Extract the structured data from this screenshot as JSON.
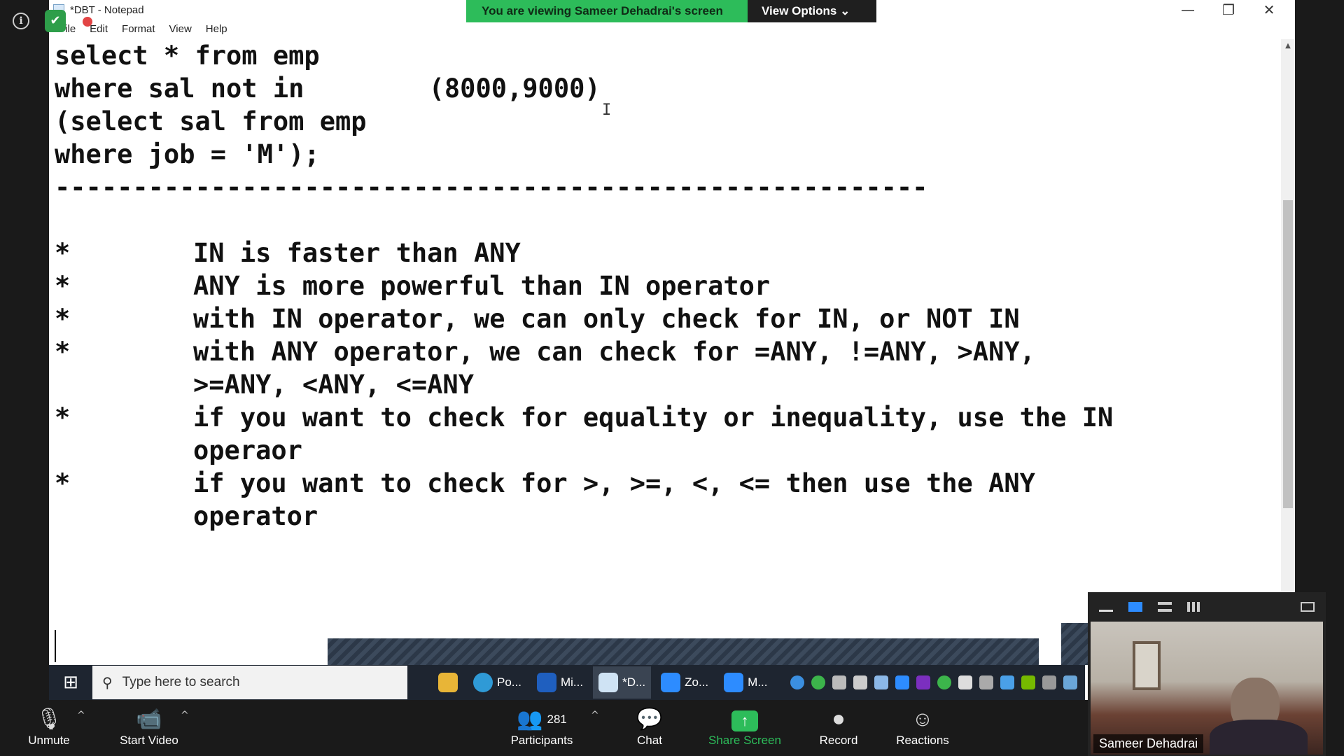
{
  "notepad": {
    "title": "*DBT - Notepad",
    "menu": [
      "File",
      "Edit",
      "Format",
      "View",
      "Help"
    ],
    "code_lines": [
      "select * from emp",
      "where sal not in        (8000,9000)",
      "(select sal from emp",
      "where job = 'M');",
      "--------------------------------------------------------",
      ""
    ],
    "bullets": [
      {
        "star": "*",
        "text": "IN is faster than ANY"
      },
      {
        "star": "*",
        "text": "ANY is more powerful than IN operator"
      },
      {
        "star": "*",
        "text": "with IN operator, we can only check for IN, or NOT IN"
      },
      {
        "star": "*",
        "text": "with ANY operator, we can check for =ANY, !=ANY, >ANY,\n>=ANY, <ANY, <=ANY"
      },
      {
        "star": "*",
        "text": "if you want to check for equality or inequality, use the IN\noperaor"
      },
      {
        "star": "*",
        "text": "if you want to check for >, >=, <, <= then use the ANY\noperator"
      }
    ]
  },
  "zoom": {
    "share_banner": "You are viewing Sameer Dehadrai's screen",
    "view_options": "View Options ⌄",
    "bottom": {
      "unmute": "Unmute",
      "start_video": "Start Video",
      "participants": "Participants",
      "participant_count": "281",
      "chat": "Chat",
      "share_screen": "Share Screen",
      "record": "Record",
      "reactions": "Reactions"
    },
    "video_name": "Sameer Dehadrai"
  },
  "taskbar": {
    "search_placeholder": "Type here to search",
    "apps": [
      "Po...",
      "Mi...",
      "*D...",
      "Zo...",
      "M..."
    ]
  },
  "colors": {
    "zoom_green": "#2dbc5a",
    "taskbar_bg": "#1e2530"
  }
}
